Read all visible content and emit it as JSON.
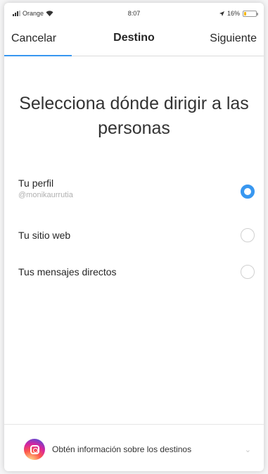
{
  "status_bar": {
    "carrier": "Orange",
    "time": "8:07",
    "battery_percent": "16%",
    "battery_level": 0.16,
    "battery_color": "#f5b400"
  },
  "nav": {
    "cancel_label": "Cancelar",
    "title": "Destino",
    "next_label": "Siguiente",
    "accent_color": "#3897f0"
  },
  "headline": "Selecciona dónde dirigir a las personas",
  "options": [
    {
      "label": "Tu perfil",
      "sublabel": "@monikaurrutia",
      "selected": true
    },
    {
      "label": "Tu sitio web",
      "selected": false
    },
    {
      "label": "Tus mensajes directos",
      "selected": false
    }
  ],
  "footer": {
    "text": "Obtén información sobre los destinos",
    "icon": "instagram-icon",
    "chevron_icon": "chevron-down-icon"
  }
}
